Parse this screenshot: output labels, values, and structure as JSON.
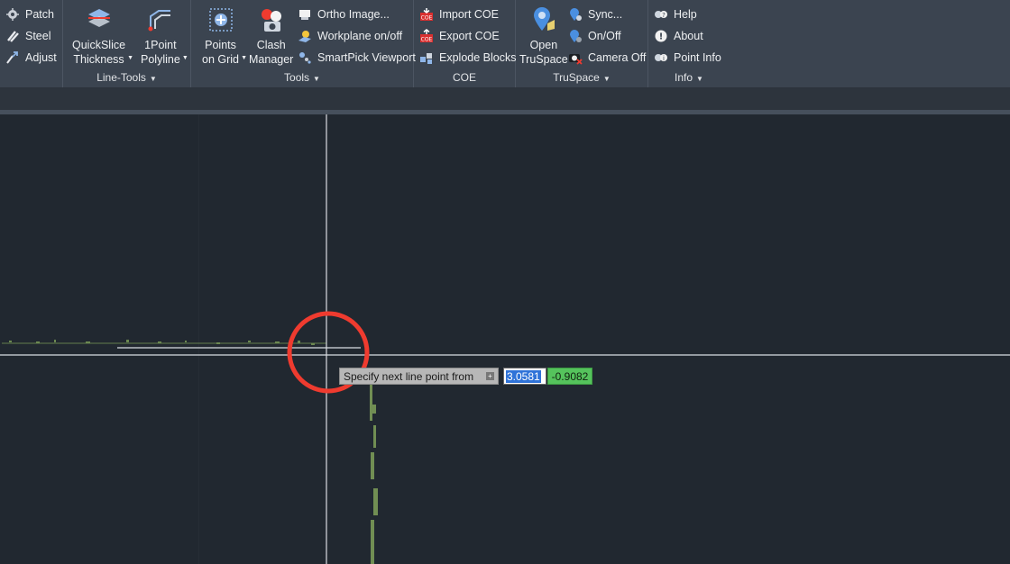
{
  "colors": {
    "ribbon_bg": "#3b4450",
    "viewport_bg": "#212830",
    "crosshair": "#d9dde2",
    "highlight_circle": "#ef3b2f",
    "point_cloud": "#7fa05a",
    "coord_y_bg": "#55c35c",
    "coord_x_selection": "#2f73d8"
  },
  "ribbon": {
    "panels": [
      {
        "title": "",
        "buttons": [
          {
            "label": "Patch",
            "icon": "patch-icon"
          },
          {
            "label": "Steel",
            "icon": "steel-icon"
          },
          {
            "label": "Adjust",
            "icon": "adjust-icon"
          }
        ]
      },
      {
        "title": "Line-Tools",
        "buttons": [
          {
            "label_line1": "QuickSlice",
            "label_line2": "Thickness",
            "icon": "quickslice-icon"
          },
          {
            "label_line1": "1Point",
            "label_line2": "Polyline",
            "icon": "polyline-icon"
          }
        ]
      },
      {
        "title": "Tools",
        "big_buttons": [
          {
            "label_line1": "Points",
            "label_line2": "on Grid",
            "icon": "points-grid-icon"
          },
          {
            "label_line1": "Clash",
            "label_line2": "Manager",
            "icon": "clash-manager-icon"
          }
        ],
        "buttons": [
          {
            "label": "Ortho Image...",
            "icon": "ortho-image-icon"
          },
          {
            "label": "Workplane on/off",
            "icon": "workplane-icon"
          },
          {
            "label": "SmartPick Viewport",
            "icon": "smartpick-icon"
          }
        ]
      },
      {
        "title": "COE",
        "buttons": [
          {
            "label": "Import COE",
            "icon": "import-coe-icon"
          },
          {
            "label": "Export COE",
            "icon": "export-coe-icon"
          },
          {
            "label": "Explode Blocks",
            "icon": "explode-blocks-icon"
          }
        ]
      },
      {
        "title": "TruSpace",
        "big_buttons": [
          {
            "label_line1": "Open",
            "label_line2": "TruSpace",
            "icon": "truspace-icon"
          }
        ],
        "buttons": [
          {
            "label": "Sync...",
            "icon": "sync-icon"
          },
          {
            "label": "On/Off",
            "icon": "onoff-icon"
          },
          {
            "label": "Camera Off",
            "icon": "camera-off-icon"
          }
        ]
      },
      {
        "title": "Info",
        "buttons": [
          {
            "label": "Help",
            "icon": "help-icon"
          },
          {
            "label": "About",
            "icon": "about-icon"
          },
          {
            "label": "Point Info",
            "icon": "point-info-icon"
          }
        ]
      }
    ]
  },
  "viewport": {
    "prompt_text": "Specify next line point from",
    "coord_x": "3.0581",
    "coord_y": "-0.9082"
  }
}
